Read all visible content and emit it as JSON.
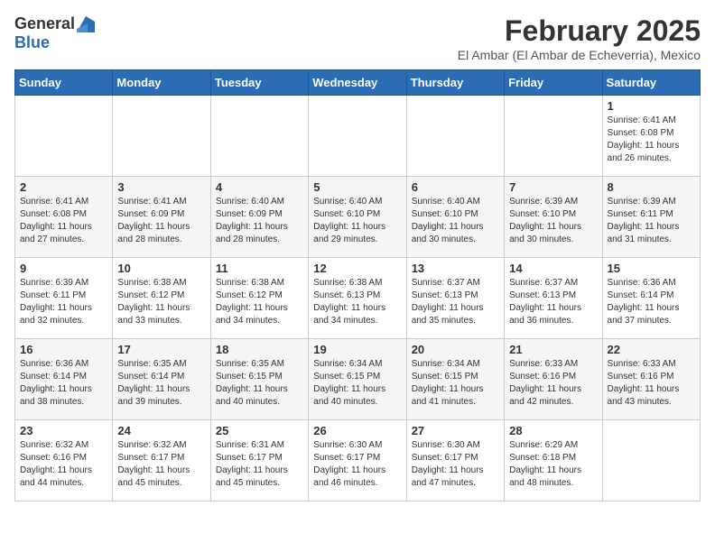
{
  "logo": {
    "general": "General",
    "blue": "Blue"
  },
  "title": "February 2025",
  "location": "El Ambar (El Ambar de Echeverria), Mexico",
  "weekdays": [
    "Sunday",
    "Monday",
    "Tuesday",
    "Wednesday",
    "Thursday",
    "Friday",
    "Saturday"
  ],
  "weeks": [
    [
      {
        "day": "",
        "info": ""
      },
      {
        "day": "",
        "info": ""
      },
      {
        "day": "",
        "info": ""
      },
      {
        "day": "",
        "info": ""
      },
      {
        "day": "",
        "info": ""
      },
      {
        "day": "",
        "info": ""
      },
      {
        "day": "1",
        "info": "Sunrise: 6:41 AM\nSunset: 6:08 PM\nDaylight: 11 hours\nand 26 minutes."
      }
    ],
    [
      {
        "day": "2",
        "info": "Sunrise: 6:41 AM\nSunset: 6:08 PM\nDaylight: 11 hours\nand 27 minutes."
      },
      {
        "day": "3",
        "info": "Sunrise: 6:41 AM\nSunset: 6:09 PM\nDaylight: 11 hours\nand 28 minutes."
      },
      {
        "day": "4",
        "info": "Sunrise: 6:40 AM\nSunset: 6:09 PM\nDaylight: 11 hours\nand 28 minutes."
      },
      {
        "day": "5",
        "info": "Sunrise: 6:40 AM\nSunset: 6:10 PM\nDaylight: 11 hours\nand 29 minutes."
      },
      {
        "day": "6",
        "info": "Sunrise: 6:40 AM\nSunset: 6:10 PM\nDaylight: 11 hours\nand 30 minutes."
      },
      {
        "day": "7",
        "info": "Sunrise: 6:39 AM\nSunset: 6:10 PM\nDaylight: 11 hours\nand 30 minutes."
      },
      {
        "day": "8",
        "info": "Sunrise: 6:39 AM\nSunset: 6:11 PM\nDaylight: 11 hours\nand 31 minutes."
      }
    ],
    [
      {
        "day": "9",
        "info": "Sunrise: 6:39 AM\nSunset: 6:11 PM\nDaylight: 11 hours\nand 32 minutes."
      },
      {
        "day": "10",
        "info": "Sunrise: 6:38 AM\nSunset: 6:12 PM\nDaylight: 11 hours\nand 33 minutes."
      },
      {
        "day": "11",
        "info": "Sunrise: 6:38 AM\nSunset: 6:12 PM\nDaylight: 11 hours\nand 34 minutes."
      },
      {
        "day": "12",
        "info": "Sunrise: 6:38 AM\nSunset: 6:13 PM\nDaylight: 11 hours\nand 34 minutes."
      },
      {
        "day": "13",
        "info": "Sunrise: 6:37 AM\nSunset: 6:13 PM\nDaylight: 11 hours\nand 35 minutes."
      },
      {
        "day": "14",
        "info": "Sunrise: 6:37 AM\nSunset: 6:13 PM\nDaylight: 11 hours\nand 36 minutes."
      },
      {
        "day": "15",
        "info": "Sunrise: 6:36 AM\nSunset: 6:14 PM\nDaylight: 11 hours\nand 37 minutes."
      }
    ],
    [
      {
        "day": "16",
        "info": "Sunrise: 6:36 AM\nSunset: 6:14 PM\nDaylight: 11 hours\nand 38 minutes."
      },
      {
        "day": "17",
        "info": "Sunrise: 6:35 AM\nSunset: 6:14 PM\nDaylight: 11 hours\nand 39 minutes."
      },
      {
        "day": "18",
        "info": "Sunrise: 6:35 AM\nSunset: 6:15 PM\nDaylight: 11 hours\nand 40 minutes."
      },
      {
        "day": "19",
        "info": "Sunrise: 6:34 AM\nSunset: 6:15 PM\nDaylight: 11 hours\nand 40 minutes."
      },
      {
        "day": "20",
        "info": "Sunrise: 6:34 AM\nSunset: 6:15 PM\nDaylight: 11 hours\nand 41 minutes."
      },
      {
        "day": "21",
        "info": "Sunrise: 6:33 AM\nSunset: 6:16 PM\nDaylight: 11 hours\nand 42 minutes."
      },
      {
        "day": "22",
        "info": "Sunrise: 6:33 AM\nSunset: 6:16 PM\nDaylight: 11 hours\nand 43 minutes."
      }
    ],
    [
      {
        "day": "23",
        "info": "Sunrise: 6:32 AM\nSunset: 6:16 PM\nDaylight: 11 hours\nand 44 minutes."
      },
      {
        "day": "24",
        "info": "Sunrise: 6:32 AM\nSunset: 6:17 PM\nDaylight: 11 hours\nand 45 minutes."
      },
      {
        "day": "25",
        "info": "Sunrise: 6:31 AM\nSunset: 6:17 PM\nDaylight: 11 hours\nand 45 minutes."
      },
      {
        "day": "26",
        "info": "Sunrise: 6:30 AM\nSunset: 6:17 PM\nDaylight: 11 hours\nand 46 minutes."
      },
      {
        "day": "27",
        "info": "Sunrise: 6:30 AM\nSunset: 6:17 PM\nDaylight: 11 hours\nand 47 minutes."
      },
      {
        "day": "28",
        "info": "Sunrise: 6:29 AM\nSunset: 6:18 PM\nDaylight: 11 hours\nand 48 minutes."
      },
      {
        "day": "",
        "info": ""
      }
    ]
  ]
}
